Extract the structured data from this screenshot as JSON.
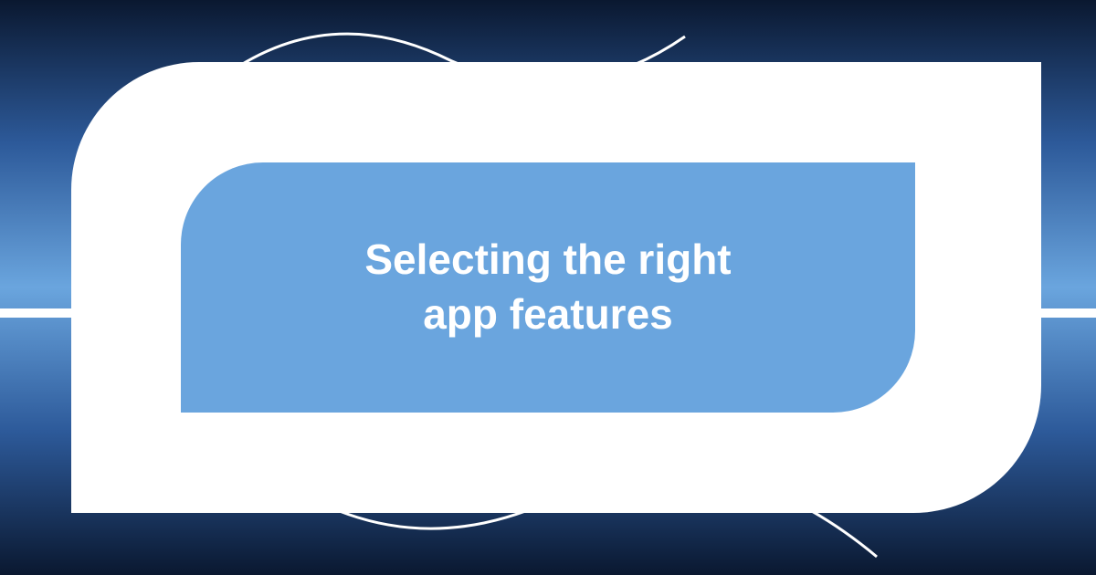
{
  "title_line1": "Selecting the right",
  "title_line2": "app features"
}
